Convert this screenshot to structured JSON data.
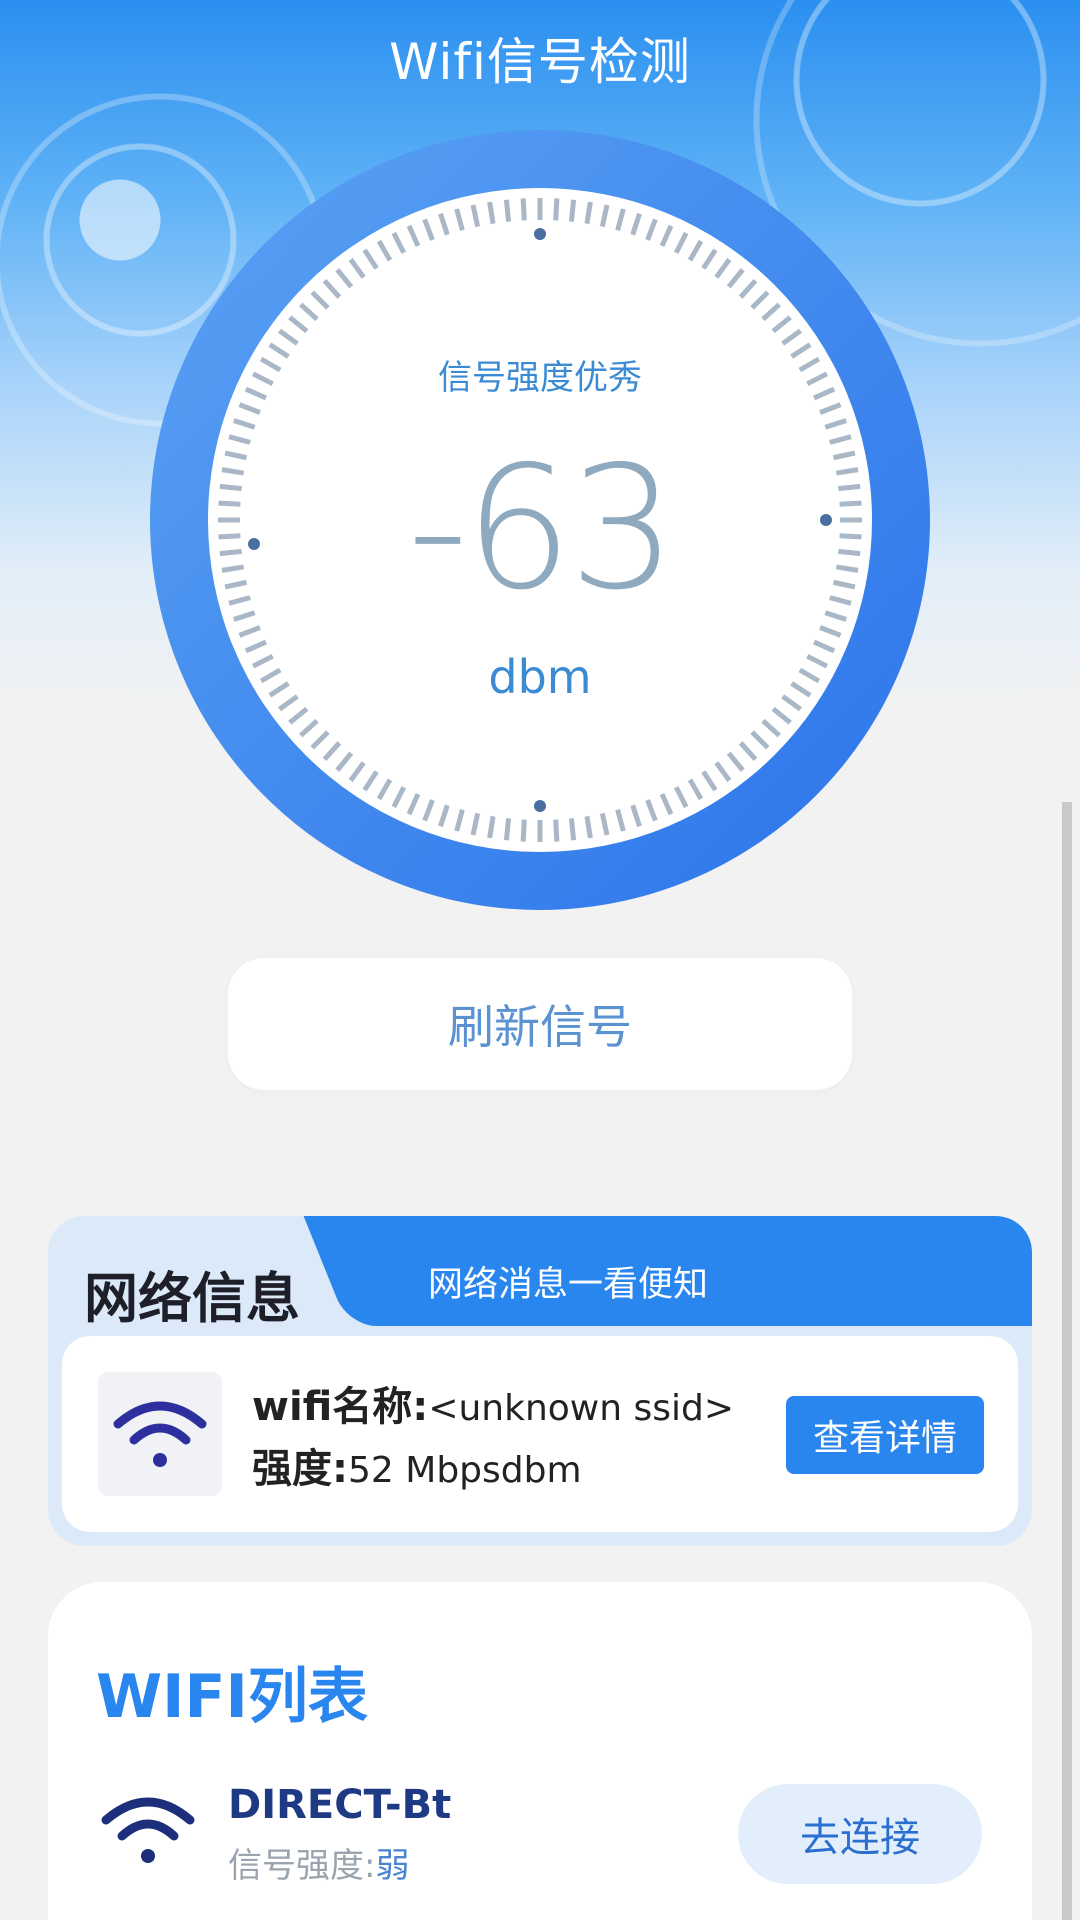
{
  "header": {
    "title": "Wifi信号检测"
  },
  "gauge": {
    "status": "信号强度优秀",
    "value": "-63",
    "unit": "dbm"
  },
  "refresh": {
    "label": "刷新信号"
  },
  "network": {
    "title": "网络信息",
    "subtitle": "网络消息一看便知",
    "name_label": "wifi名称:",
    "name_value": "<unknown ssid>",
    "strength_label": "强度:",
    "strength_value": "52 Mbpsdbm",
    "detail_button": "查看详情"
  },
  "wifi_list": {
    "title": "WIFI列表",
    "items": [
      {
        "name": "DIRECT-Bt",
        "strength_label": "信号强度:",
        "strength_value": "弱",
        "action": "去连接"
      }
    ]
  },
  "colors": {
    "accent": "#2a86ef",
    "gauge_ring": "#3b87ee",
    "text_dark": "#1f1f2a"
  },
  "icons": {
    "wifi": "wifi-icon"
  }
}
